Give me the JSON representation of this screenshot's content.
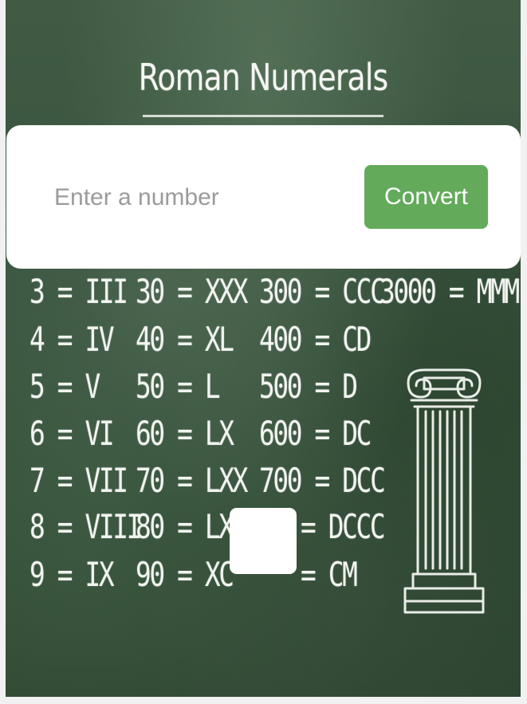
{
  "board": {
    "title": "Roman Numerals"
  },
  "converter": {
    "input_value": "",
    "input_placeholder": "Enter a number",
    "button_label": "Convert",
    "button_color": "#63aa5a"
  },
  "numerals": {
    "col1": [
      "3 = III",
      "4 = IV",
      "5 = V",
      "6 = VI",
      "7 = VII",
      "8 = VIII",
      "9 = IX"
    ],
    "col2": [
      "30 = XXX",
      "40 = XL",
      "50 = L",
      "60 = LX",
      "70 = LXX",
      "80 = LXX",
      "90 = XC"
    ],
    "col3": [
      "300 = CCC",
      "400 = CD",
      "500 = D",
      "600 = DC",
      "700 = DCC",
      "= DCCC",
      "= CM"
    ],
    "col4": [
      "3000 = MMM"
    ]
  },
  "decor": {
    "column_icon": "ionic-column-icon"
  }
}
